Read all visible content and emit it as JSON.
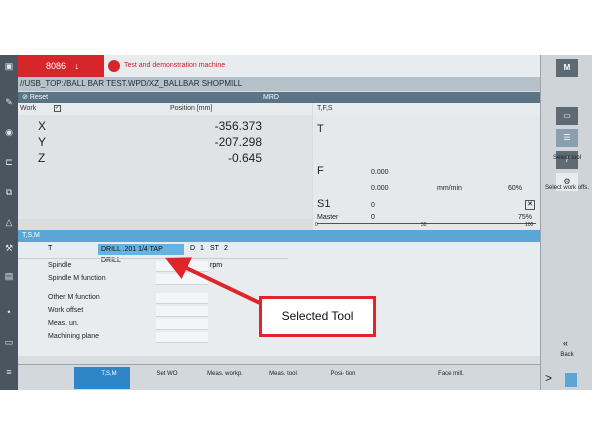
{
  "header": {
    "channel": "8086",
    "demo_text": "Test and demonstration machine"
  },
  "path": "//USB_TOP:/BALL BAR TEST.WPD/XZ_BALLBAR SHOPMILL",
  "status_bar": {
    "reset_label": "Reset",
    "mode": "MRD"
  },
  "position": {
    "work_label": "Work",
    "header_label": "Position [mm]",
    "axes": [
      {
        "name": "X",
        "value": "-356.373"
      },
      {
        "name": "Y",
        "value": "-207.298"
      },
      {
        "name": "Z",
        "value": "-0.645"
      }
    ]
  },
  "tfs": {
    "header": "T,F,S",
    "t_label": "T",
    "f_label": "F",
    "f_value": "0.000",
    "f_value2": "0.000",
    "f_unit": "mm/min",
    "f_override": "60%",
    "s_label": "S1",
    "s_value": "0",
    "master_label": "Master",
    "master_value": "0",
    "s_override": "75%",
    "scale": [
      "0",
      "50",
      "100"
    ]
  },
  "tsm": {
    "header": "T,S,M",
    "t_label": "T",
    "tool_name": "DRILL .201 1/4 TAP DRILL",
    "d_label": "D",
    "d_value": "1",
    "st_label": "ST",
    "st_value": "2",
    "spindle_label": "Spindle",
    "spindle_unit": "rpm",
    "spindle_m_label": "Spindle M function",
    "other_m_label": "Other M function",
    "work_offset_label": "Work offset",
    "meas_unit_label": "Meas. un.",
    "machining_plane_label": "Machining plane"
  },
  "right_softkeys": {
    "select_tool": "Select tool",
    "select_work_offs": "Select work offs.",
    "back": "Back",
    "machine_label": "M"
  },
  "bottom_softkeys": {
    "tsm": "T,S,M",
    "set_wo": "Set WO",
    "meas_workp": "Meas. workp.",
    "meas_tool": "Meas. tool",
    "position": "Posi- tion",
    "face_mill": "Face mill."
  },
  "annotation": {
    "text": "Selected Tool"
  },
  "colors": {
    "accent_blue": "#5aa6d6",
    "header_red": "#d7262b",
    "callout_red": "#e1232a"
  }
}
